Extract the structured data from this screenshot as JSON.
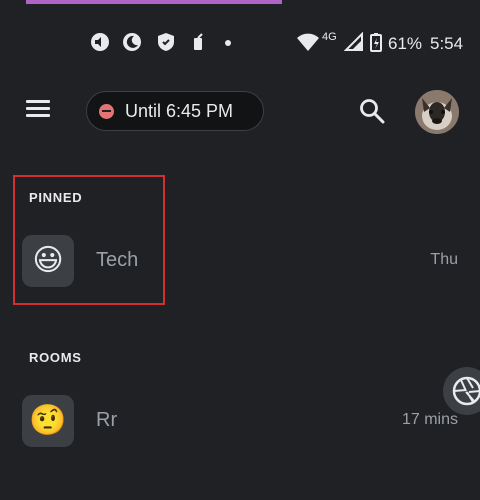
{
  "status_bar": {
    "network_type": "4G",
    "battery_percent": "61%",
    "time": "5:54"
  },
  "app_bar": {
    "menu_icon": "hamburger-menu-icon",
    "dnd_status": "Until 6:45 PM",
    "search_icon": "search-icon",
    "avatar": "profile-avatar"
  },
  "pinned": {
    "label": "PINNED",
    "items": [
      {
        "name": "Tech",
        "emoji": "😃",
        "time": "Thu"
      }
    ]
  },
  "rooms": {
    "label": "ROOMS",
    "items": [
      {
        "name": "Rr",
        "emoji": "🤨",
        "time": "17 mins"
      }
    ]
  },
  "colors": {
    "background": "#202124",
    "highlight": "#d32f2f",
    "accent_strip": "#b164c8"
  }
}
